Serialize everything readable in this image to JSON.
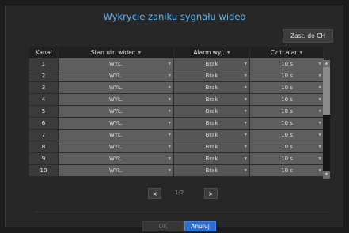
{
  "dialog": {
    "title": "Wykrycie zaniku sygnału wideo"
  },
  "toolbar": {
    "copy_label": "Zast. do CH"
  },
  "table": {
    "headers": {
      "channel": "Kanał",
      "stan": "Stan utr. wideo",
      "alarm": "Alarm wyj.",
      "czas": "Cz.tr.alar"
    },
    "rows": [
      {
        "channel": "1",
        "stan": "WYŁ.",
        "alarm": "Brak",
        "czas": "10 s"
      },
      {
        "channel": "2",
        "stan": "WYŁ.",
        "alarm": "Brak",
        "czas": "10 s"
      },
      {
        "channel": "3",
        "stan": "WYŁ.",
        "alarm": "Brak",
        "czas": "10 s"
      },
      {
        "channel": "4",
        "stan": "WYŁ.",
        "alarm": "Brak",
        "czas": "10 s"
      },
      {
        "channel": "5",
        "stan": "WYŁ.",
        "alarm": "Brak",
        "czas": "10 s"
      },
      {
        "channel": "6",
        "stan": "WYŁ.",
        "alarm": "Brak",
        "czas": "10 s"
      },
      {
        "channel": "7",
        "stan": "WYŁ.",
        "alarm": "Brak",
        "czas": "10 s"
      },
      {
        "channel": "8",
        "stan": "WYŁ.",
        "alarm": "Brak",
        "czas": "10 s"
      },
      {
        "channel": "9",
        "stan": "WYŁ.",
        "alarm": "Brak",
        "czas": "10 s"
      },
      {
        "channel": "10",
        "stan": "WYŁ.",
        "alarm": "Brak",
        "czas": "10 s"
      }
    ]
  },
  "pager": {
    "text": "1/2",
    "prev_glyph": "<",
    "next_glyph": ">"
  },
  "footer": {
    "ok_label": "OK",
    "cancel_label": "Anuluj"
  },
  "colors": {
    "title": "#5bb4f2",
    "primary_button": "#2d6fcf"
  }
}
